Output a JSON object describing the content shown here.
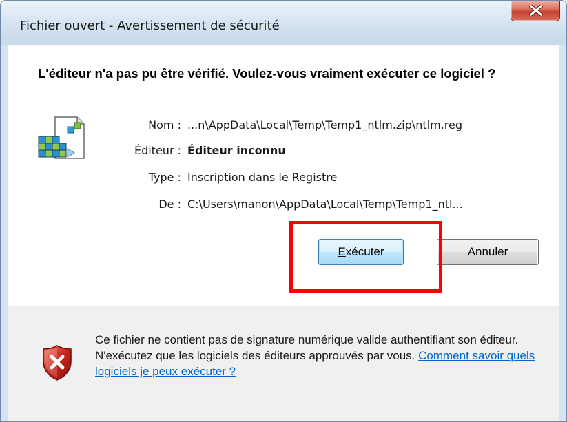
{
  "window": {
    "title": "Fichier ouvert - Avertissement de sécurité"
  },
  "dialog": {
    "heading": "L'éditeur n'a pas pu être vérifié. Voulez-vous vraiment exécuter ce logiciel ?",
    "fields": {
      "name_label": "Nom :",
      "name_value": "...n\\AppData\\Local\\Temp\\Temp1_ntlm.zip\\ntlm.reg",
      "publisher_label": "Éditeur :",
      "publisher_value": "Éditeur inconnu",
      "type_label": "Type :",
      "type_value": "Inscription dans le Registre",
      "from_label": "De :",
      "from_value": "C:\\Users\\manon\\AppData\\Local\\Temp\\Temp1_ntl..."
    },
    "buttons": {
      "run_first": "E",
      "run_rest": "xécuter",
      "cancel": "Annuler"
    }
  },
  "footer": {
    "message": "Ce fichier ne contient pas de signature numérique valide authentifiant son éditeur. N'exécutez que les logiciels des éditeurs approuvés par vous. ",
    "link": "Comment savoir quels logiciels je peux exécuter ?"
  },
  "colors": {
    "highlight": "#ff0000",
    "link": "#0066cc",
    "close_button": "#c2402f"
  },
  "icons": {
    "close": "close-icon",
    "file": "registry-file-icon",
    "warning": "warning-shield-icon"
  }
}
